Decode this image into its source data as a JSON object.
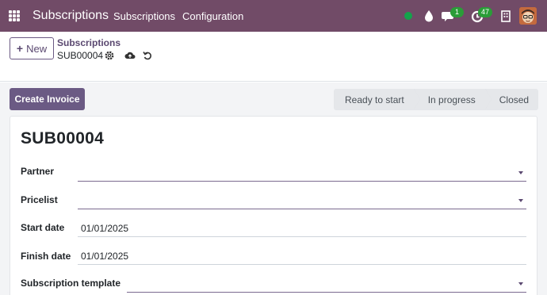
{
  "navbar": {
    "app_title": "Subscriptions",
    "menu": [
      {
        "label": "Subscriptions"
      },
      {
        "label": "Configuration"
      }
    ],
    "messages_badge": "1",
    "activities_badge": "47",
    "accent_color": "#714b67"
  },
  "control_panel": {
    "new_label": "New",
    "breadcrumb_parent": "Subscriptions",
    "record_ref": "SUB00004"
  },
  "actions": {
    "create_invoice_label": "Create Invoice"
  },
  "statusbar": {
    "stages": [
      {
        "label": "Ready to start"
      },
      {
        "label": "In progress"
      },
      {
        "label": "Closed"
      }
    ]
  },
  "form": {
    "title": "SUB00004",
    "fields": {
      "partner": {
        "label": "Partner",
        "value": ""
      },
      "pricelist": {
        "label": "Pricelist",
        "value": ""
      },
      "start_date": {
        "label": "Start date",
        "value": "01/01/2025"
      },
      "finish_date": {
        "label": "Finish date",
        "value": "01/01/2025"
      },
      "subscription_template": {
        "label": "Subscription template",
        "value": ""
      }
    }
  }
}
